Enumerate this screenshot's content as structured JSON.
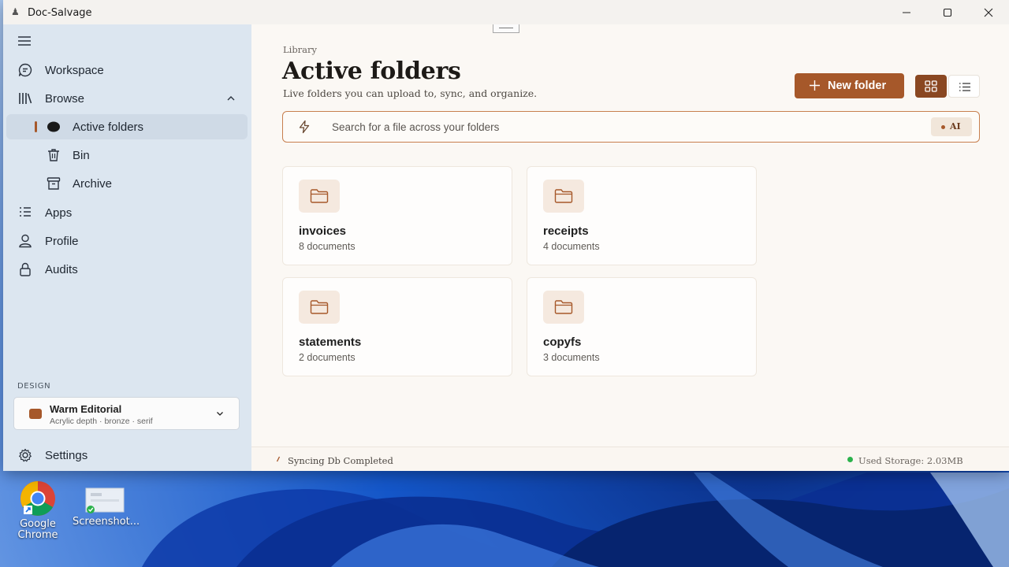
{
  "window": {
    "title": "Doc-Salvage"
  },
  "sidebar": {
    "items": [
      {
        "label": "Workspace",
        "icon": "chat-icon"
      },
      {
        "label": "Browse",
        "icon": "library-icon"
      },
      {
        "label": "Active folders",
        "icon": "dot-icon"
      },
      {
        "label": "Bin",
        "icon": "trash-icon"
      },
      {
        "label": "Archive",
        "icon": "archive-icon"
      },
      {
        "label": "Apps",
        "icon": "apps-list-icon"
      },
      {
        "label": "Profile",
        "icon": "person-icon"
      },
      {
        "label": "Audits",
        "icon": "lock-icon"
      }
    ],
    "design": {
      "heading": "DESIGN",
      "name": "Warm Editorial",
      "description": "Acrylic depth · bronze · serif",
      "swatch_color": "#a6582a"
    },
    "settings_label": "Settings"
  },
  "main": {
    "breadcrumb": "Library",
    "title": "Active folders",
    "subtitle": "Live folders you can upload to, sync, and organize.",
    "new_folder_label": "New folder",
    "search": {
      "placeholder": "Search for a file across your folders",
      "ai_label": "AI"
    },
    "folders": [
      {
        "name": "invoices",
        "count": "8 documents"
      },
      {
        "name": "receipts",
        "count": "4 documents"
      },
      {
        "name": "statements",
        "count": "2 documents"
      },
      {
        "name": "copyfs",
        "count": "3 documents"
      }
    ],
    "status": {
      "sync_text": "Syncing Db Completed",
      "storage_text": "Used Storage:  2.03MB"
    }
  },
  "desktop": {
    "icons": [
      {
        "label": "Google Chrome"
      },
      {
        "label": "Screenshot..."
      }
    ]
  },
  "colors": {
    "accent": "#a6582a",
    "accent_dark": "#8a4721",
    "sidebar_bg": "#dce6f0",
    "main_bg": "#fbf8f4",
    "status_ok": "#2bb24c"
  }
}
